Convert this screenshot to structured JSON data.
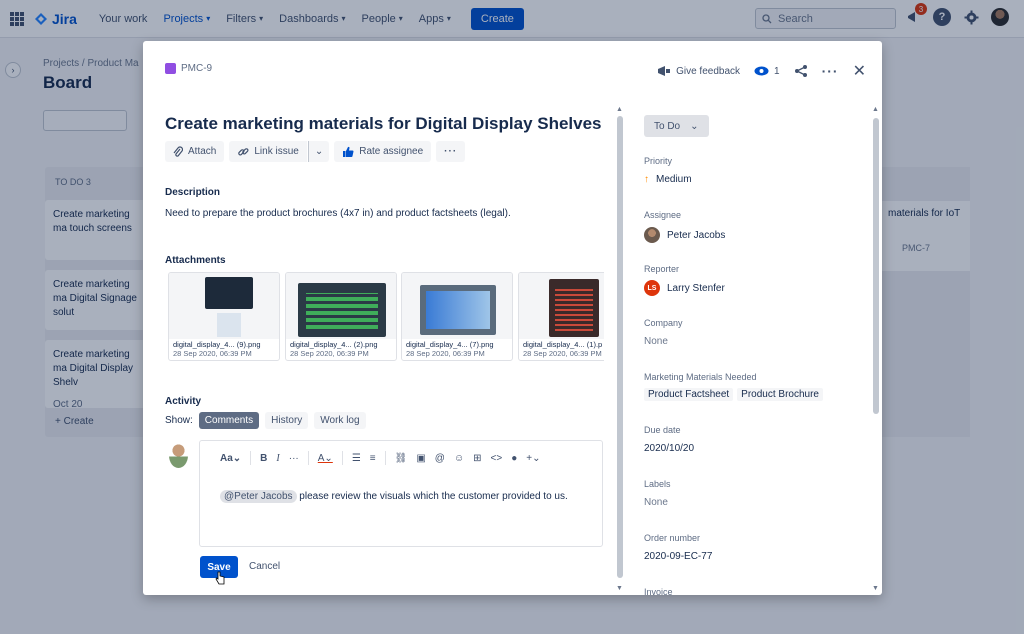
{
  "topnav": {
    "logo": "Jira",
    "items": [
      {
        "label": "Your work",
        "chevron": false
      },
      {
        "label": "Projects",
        "chevron": true
      },
      {
        "label": "Filters",
        "chevron": true
      },
      {
        "label": "Dashboards",
        "chevron": true
      },
      {
        "label": "People",
        "chevron": true
      },
      {
        "label": "Apps",
        "chevron": true
      }
    ],
    "create_label": "Create",
    "search_placeholder": "Search",
    "notification_count": "3"
  },
  "board": {
    "breadcrumb_projects": "Projects",
    "breadcrumb_sep": "/",
    "breadcrumb_project": "Product Ma",
    "title": "Board",
    "column_title": "TO DO 3",
    "cards": [
      {
        "text": "Create marketing ma touch screens"
      },
      {
        "text": "Create marketing ma Digital Signage solut"
      },
      {
        "text": "Create marketing ma Digital Display Shelv",
        "date": "Oct 20"
      }
    ],
    "right_card_text": "materials for IoT",
    "right_card_key": "PMC-7",
    "create_label": "+ Create"
  },
  "issue": {
    "key": "PMC-9",
    "give_feedback": "Give feedback",
    "watch_count": "1",
    "title": "Create marketing materials for Digital Display Shelves",
    "toolbar": {
      "attach": "Attach",
      "link_issue": "Link issue",
      "rate_assignee": "Rate assignee"
    },
    "description_label": "Description",
    "description": "Need to prepare the product brochures (4x7 in) and product factsheets (legal).",
    "attachments_label": "Attachments",
    "attachments": [
      {
        "name": "digital_display_4... (9).png",
        "date": "28 Sep 2020, 06:39 PM"
      },
      {
        "name": "digital_display_4... (2).png",
        "date": "28 Sep 2020, 06:39 PM"
      },
      {
        "name": "digital_display_4... (7).png",
        "date": "28 Sep 2020, 06:39 PM"
      },
      {
        "name": "digital_display_4... (1).p",
        "date": "28 Sep 2020, 06:39 PM"
      }
    ],
    "activity_label": "Activity",
    "show_label": "Show:",
    "activity_tabs": [
      "Comments",
      "History",
      "Work log"
    ],
    "comment_mention": "@Peter Jacobs",
    "comment_text": "please review the visuals which the customer provided to us.",
    "save_label": "Save",
    "cancel_label": "Cancel",
    "status": "To Do",
    "fields": {
      "priority_label": "Priority",
      "priority_value": "Medium",
      "assignee_label": "Assignee",
      "assignee_value": "Peter Jacobs",
      "reporter_label": "Reporter",
      "reporter_initials": "LS",
      "reporter_value": "Larry Stenfer",
      "company_label": "Company",
      "company_value": "None",
      "marketing_label": "Marketing Materials Needed",
      "marketing_values": [
        "Product Factsheet",
        "Product Brochure"
      ],
      "due_label": "Due date",
      "due_value": "2020/10/20",
      "labels_label": "Labels",
      "labels_value": "None",
      "order_label": "Order number",
      "order_value": "2020-09-EC-77",
      "invoice_label": "Invoice"
    }
  },
  "colors": {
    "primary": "#0052cc",
    "text": "#172b4d",
    "muted": "#6b778c",
    "epic_purple": "#904ee2",
    "reporter_red": "#de350b",
    "priority_orange": "#ff8b00"
  }
}
